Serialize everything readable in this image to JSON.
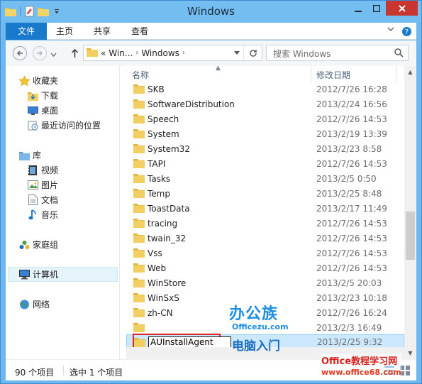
{
  "window": {
    "title": "Windows"
  },
  "ribbon": {
    "tabs": [
      "文件",
      "主页",
      "共享",
      "查看"
    ]
  },
  "address": {
    "overflow": "«",
    "segments": [
      "Win...",
      "Windows"
    ],
    "search_placeholder": "搜索 Windows"
  },
  "nav": {
    "favorites": {
      "label": "收藏夹",
      "items": [
        "下载",
        "桌面",
        "最近访问的位置"
      ]
    },
    "library": {
      "label": "库",
      "items": [
        "视频",
        "图片",
        "文档",
        "音乐"
      ]
    },
    "homegroup": "家庭组",
    "computer": "计算机",
    "network": "网络"
  },
  "columns": {
    "name": "名称",
    "date": "修改日期"
  },
  "files": [
    {
      "name": "SKB",
      "date": "2012/7/26 16:28"
    },
    {
      "name": "SoftwareDistribution",
      "date": "2013/2/24 16:56"
    },
    {
      "name": "Speech",
      "date": "2012/7/26 14:53"
    },
    {
      "name": "System",
      "date": "2013/2/19 13:39"
    },
    {
      "name": "System32",
      "date": "2013/2/23 8:58"
    },
    {
      "name": "TAPI",
      "date": "2012/7/26 14:53"
    },
    {
      "name": "Tasks",
      "date": "2013/2/5 0:50"
    },
    {
      "name": "Temp",
      "date": "2013/2/25 8:48"
    },
    {
      "name": "ToastData",
      "date": "2013/2/17 11:49"
    },
    {
      "name": "tracing",
      "date": "2012/7/26 14:53"
    },
    {
      "name": "twain_32",
      "date": "2012/7/26 14:53"
    },
    {
      "name": "Vss",
      "date": "2012/7/26 14:53"
    },
    {
      "name": "Web",
      "date": "2012/7/26 14:53"
    },
    {
      "name": "WinStore",
      "date": "2013/2/5 20:03"
    },
    {
      "name": "WinSxS",
      "date": "2013/2/23 10:18"
    },
    {
      "name": "zh-CN",
      "date": "2012/7/26 16:24"
    },
    {
      "name": "",
      "date": "2013/2/3 16:49"
    }
  ],
  "renaming": {
    "value": "AUInstallAgent",
    "date": "2013/2/25 9:32"
  },
  "status": {
    "count": "90 个项目",
    "selected": "选中 1 个项目"
  },
  "watermarks": {
    "logo": "办公族",
    "logo_url": "Officezu.com",
    "tagline": "电脑入门",
    "site": "Office教程学习网",
    "site_url": "www.office68.com"
  },
  "colors": {
    "accent": "#1979ca",
    "selection": "#cce8ff",
    "highlight_box": "#e0262b"
  }
}
